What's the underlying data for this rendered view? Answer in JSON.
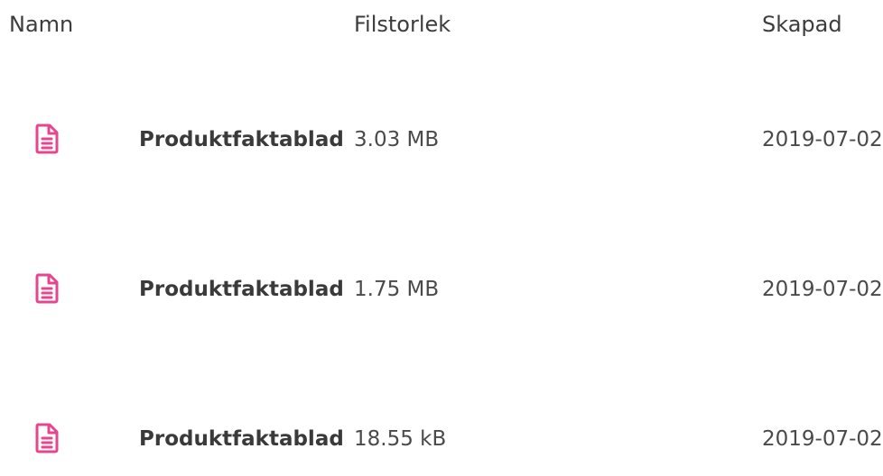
{
  "table": {
    "headers": {
      "name": "Namn",
      "size": "Filstorlek",
      "created": "Skapad"
    },
    "rows": [
      {
        "icon": "document-icon",
        "name": "Produktfaktablad",
        "size": "3.03 MB",
        "created": "2019-07-02"
      },
      {
        "icon": "document-icon",
        "name": "Produktfaktablad",
        "size": "1.75 MB",
        "created": "2019-07-02"
      },
      {
        "icon": "document-icon",
        "name": "Produktfaktablad",
        "size": "18.55 kB",
        "created": "2019-07-02"
      }
    ]
  },
  "colors": {
    "icon": "#e6458f",
    "text": "#3a3a3a"
  }
}
